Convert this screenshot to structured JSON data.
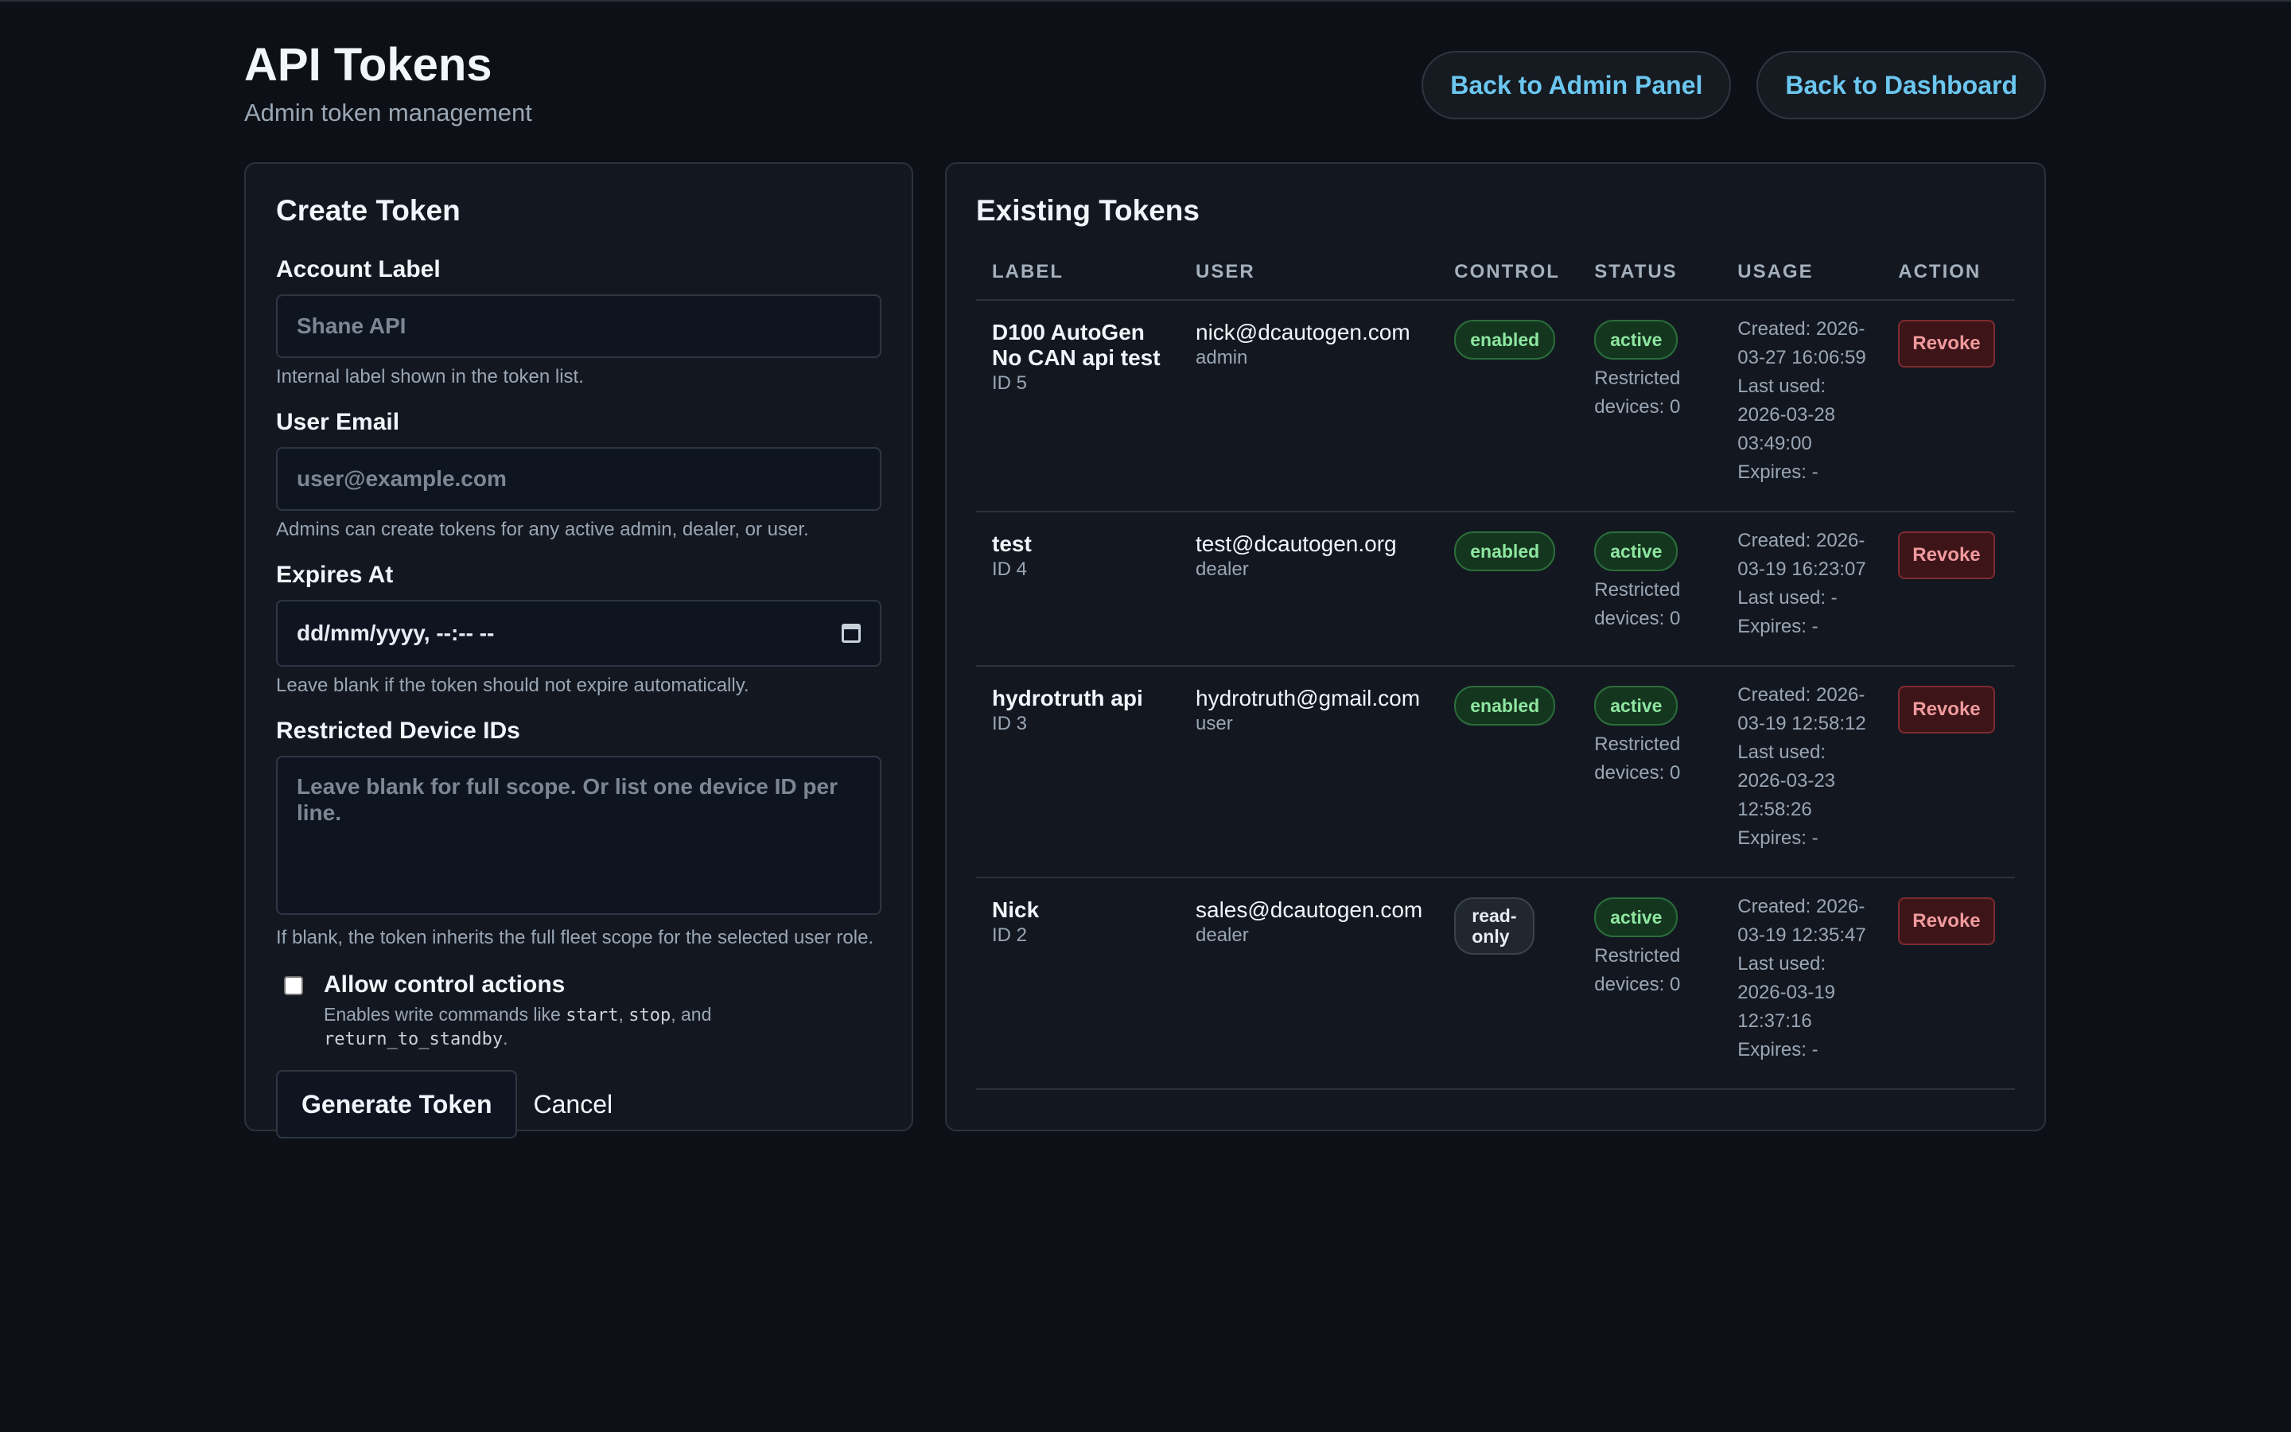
{
  "header": {
    "title": "API Tokens",
    "subtitle": "Admin token management",
    "back_admin": "Back to Admin Panel",
    "back_dashboard": "Back to Dashboard"
  },
  "create_form": {
    "title": "Create Token",
    "account_label": {
      "label": "Account Label",
      "placeholder": "Shane API",
      "help": "Internal label shown in the token list."
    },
    "user_email": {
      "label": "User Email",
      "placeholder": "user@example.com",
      "help": "Admins can create tokens for any active admin, dealer, or user."
    },
    "expires_at": {
      "label": "Expires At",
      "value": "dd/mm/yyyy, --:-- --",
      "help": "Leave blank if the token should not expire automatically."
    },
    "restricted_devices": {
      "label": "Restricted Device IDs",
      "placeholder": "Leave blank for full scope. Or list one device ID per line.",
      "help": "If blank, the token inherits the full fleet scope for the selected user role."
    },
    "allow_control": {
      "label": "Allow control actions",
      "help_prefix": "Enables write commands like ",
      "cmd1": "start",
      "sep1": ", ",
      "cmd2": "stop",
      "sep2": ", and ",
      "cmd3": "return_to_standby",
      "help_suffix": ".",
      "checked": false
    },
    "generate_label": "Generate Token",
    "cancel_label": "Cancel"
  },
  "tokens": {
    "title": "Existing Tokens",
    "columns": [
      "LABEL",
      "USER",
      "CONTROL",
      "STATUS",
      "USAGE",
      "ACTION"
    ],
    "rows": [
      {
        "label": "D100 AutoGen No CAN api test",
        "id": "ID 5",
        "email": "nick@dcautogen.com",
        "role": "admin",
        "control": "enabled",
        "status": "active",
        "restricted": "Restricted devices: 0",
        "usage": [
          "Created: 2026-",
          "03-27 16:06:59",
          "Last used:",
          "2026-03-28",
          "03:49:00",
          "Expires: -"
        ],
        "action": "Revoke"
      },
      {
        "label": "test",
        "id": "ID 4",
        "email": "test@dcautogen.org",
        "role": "dealer",
        "control": "enabled",
        "status": "active",
        "restricted": "Restricted devices: 0",
        "usage": [
          "Created: 2026-",
          "03-19 16:23:07",
          "Last used: -",
          "Expires: -"
        ],
        "action": "Revoke"
      },
      {
        "label": "hydrotruth api",
        "id": "ID 3",
        "email": "hydrotruth@gmail.com",
        "role": "user",
        "control": "enabled",
        "status": "active",
        "restricted": "Restricted devices: 0",
        "usage": [
          "Created: 2026-",
          "03-19 12:58:12",
          "Last used:",
          "2026-03-23",
          "12:58:26",
          "Expires: -"
        ],
        "action": "Revoke"
      },
      {
        "label": "Nick",
        "id": "ID 2",
        "email": "sales@dcautogen.com",
        "role": "dealer",
        "control": "read-only",
        "status": "active",
        "restricted": "Restricted devices: 0",
        "usage": [
          "Created: 2026-",
          "03-19 12:35:47",
          "Last used:",
          "2026-03-19",
          "12:37:16",
          "Expires: -"
        ],
        "action": "Revoke"
      }
    ]
  },
  "colors": {
    "background": "#0d1117",
    "panel": "#131820",
    "accent_link": "#6bc7ef",
    "enabled_pill": "#8ee6a0",
    "revoke": "#f09a9c"
  },
  "icons": {
    "date_picker": "calendar-icon"
  }
}
